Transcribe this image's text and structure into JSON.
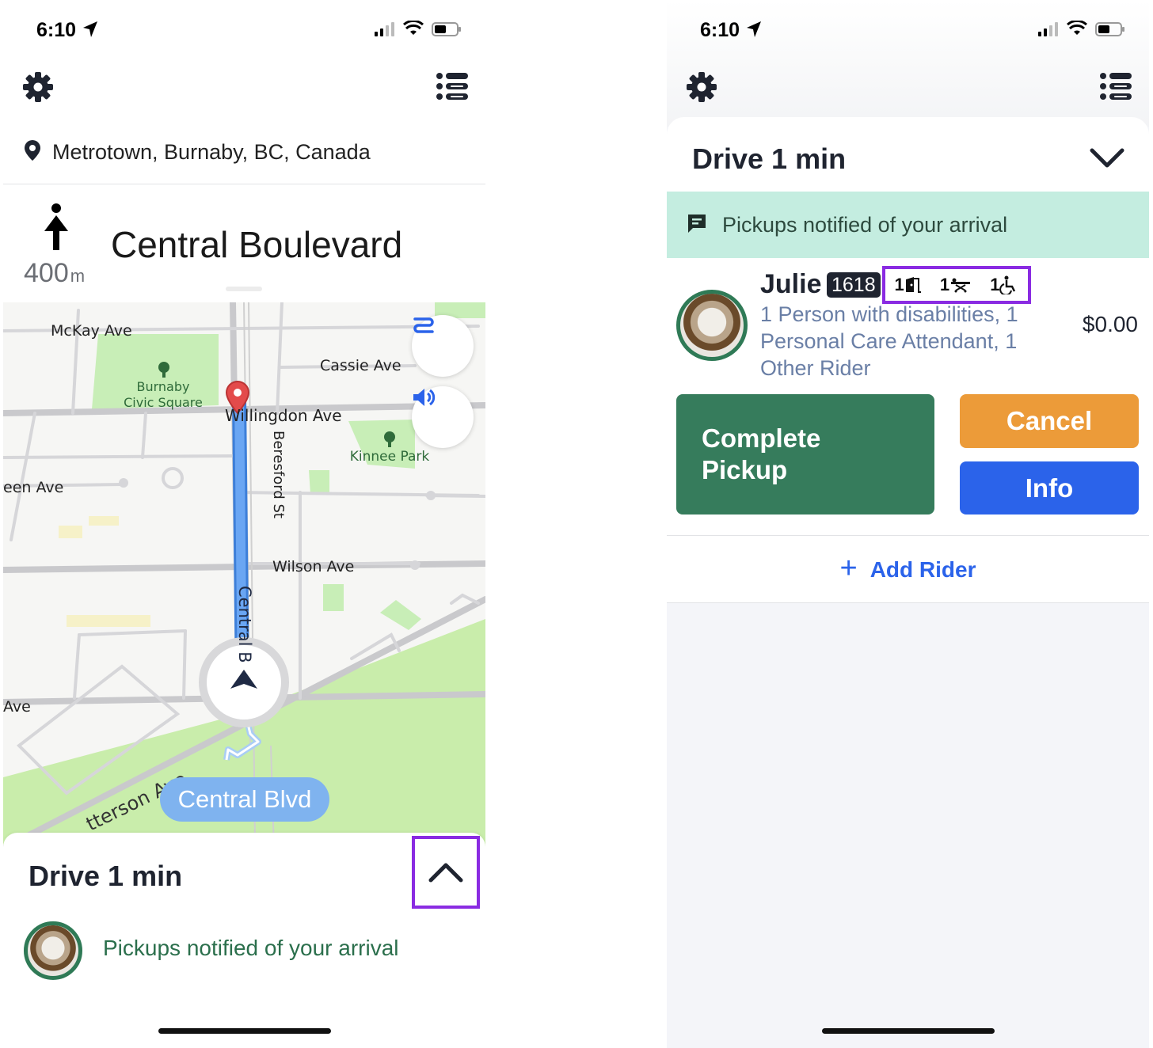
{
  "left_screen": {
    "status": {
      "time": "6:10"
    },
    "location": {
      "text": "Metrotown, Burnaby, BC, Canada"
    },
    "maneuver": {
      "distance": "400",
      "unit": "m",
      "street": "Central Boulevard"
    },
    "map": {
      "labels": {
        "mckay": "McKay Ave",
        "burnaby1": "Burnaby",
        "burnaby2": "Civic Square",
        "cassie": "Cassie Ave",
        "willingdon": "Willingdon Ave",
        "beresford": "Beresford St",
        "kinnee": "Kinnee Park",
        "een": "een Ave",
        "wilson": "Wilson Ave",
        "central_road": "Central B",
        "ave": "Ave",
        "patterson": "tterson Ave"
      },
      "current_street_pill": "Central Blvd"
    },
    "sheet": {
      "title": "Drive 1 min",
      "notification": "Pickups notified of your arrival"
    }
  },
  "right_screen": {
    "status": {
      "time": "6:10"
    },
    "sheet": {
      "title": "Drive 1 min",
      "notification": "Pickups notified of your arrival",
      "rider": {
        "name": "Julie",
        "id": "1618",
        "counts": {
          "door": "1",
          "stretcher": "1",
          "wheelchair": "1"
        },
        "description": "1 Person with disabilities, 1 Personal Care Attendant, 1 Other Rider",
        "fare": "$0.00"
      },
      "buttons": {
        "complete": "Complete Pickup",
        "cancel": "Cancel",
        "info": "Info"
      },
      "add_rider": "Add Rider"
    }
  },
  "colors": {
    "highlight": "#8a2be2",
    "complete": "#367c5c",
    "cancel": "#ec9b39",
    "info": "#2b63ea",
    "notification_bg": "#c4ede0",
    "route": "#5e9ff0"
  },
  "icons": [
    "location-arrow-icon",
    "signal-icon",
    "wifi-icon",
    "battery-icon",
    "gear-icon",
    "list-icon",
    "map-pin-icon",
    "straight-arrow-icon",
    "route-icon",
    "speaker-icon",
    "chevron-up-icon",
    "chevron-down-icon",
    "message-icon",
    "door-icon",
    "stretcher-icon",
    "wheelchair-icon",
    "plus-icon"
  ]
}
